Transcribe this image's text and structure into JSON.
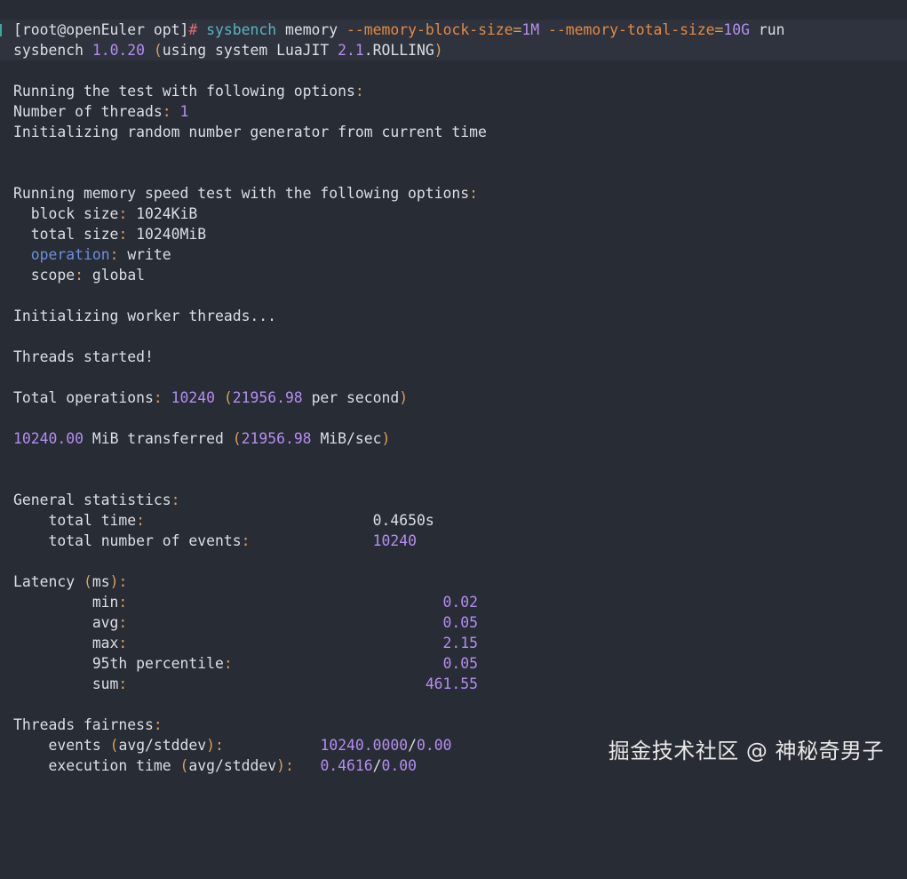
{
  "terminal": {
    "prompt": {
      "bracket_open": "[",
      "user_host": "root@openEuler opt",
      "bracket_close": "]",
      "hash": "#",
      "command": "sysbench",
      "arg1": "memory",
      "flag1": "--memory-block-size",
      "eq1": "=",
      "val1": "1M",
      "flag2": "--memory-total-size",
      "eq2": "=",
      "val2": "10G",
      "arg2": "run"
    },
    "version": {
      "name": "sysbench",
      "number": "1.0.20",
      "paren_open": "(",
      "text": "using system LuaJIT",
      "lj_version": "2.1",
      "lj_suffix": ".ROLLING",
      "paren_close": ")"
    },
    "options_header": "Running the test with following options",
    "threads_label": "Number of threads",
    "threads_value": "1",
    "rng_line": "Initializing random number generator from current time",
    "mem_header": "Running memory speed test with the following options",
    "block_size_label": "block size",
    "block_size_value": "1024KiB",
    "total_size_label": "total size",
    "total_size_value": "10240MiB",
    "operation_label": "operation",
    "operation_value": "write",
    "scope_label": "scope",
    "scope_value": "global",
    "init_workers": "Initializing worker threads...",
    "threads_started": "Threads started!",
    "total_ops_label": "Total operations",
    "total_ops_value": "10240",
    "total_ops_rate": "21956.98",
    "total_ops_unit": "per second",
    "transferred_value": "10240.00",
    "transferred_text": "MiB transferred",
    "transferred_rate": "21956.98",
    "transferred_unit": "MiB/sec",
    "general_header": "General statistics",
    "total_time_label": "total time",
    "total_time_value": "0.4650s",
    "total_events_label": "total number of events",
    "total_events_value": "10240",
    "latency_header": "Latency",
    "latency_unit": "ms",
    "latency": [
      {
        "label": "min",
        "value": "0.02"
      },
      {
        "label": "avg",
        "value": "0.05"
      },
      {
        "label": "max",
        "value": "2.15"
      },
      {
        "label": "95th percentile",
        "value": "0.05"
      },
      {
        "label": "sum",
        "value": "461.55"
      }
    ],
    "fairness_header": "Threads fairness",
    "events_label": "events",
    "events_paren": "avg/stddev",
    "events_value": "10240.0000",
    "events_stddev": "0.00",
    "exec_label": "execution time",
    "exec_paren": "avg/stddev",
    "exec_value": "0.4616",
    "exec_stddev": "0.00"
  },
  "watermark": "掘金技术社区 @ 神秘奇男子",
  "colors": {
    "background": "#282c34",
    "text": "#dcdfe4",
    "punctuation": "#d6a05f",
    "number": "#b48ef0",
    "command": "#56b6c2",
    "flag": "#e38a44",
    "keyword": "#6b8fe0"
  }
}
